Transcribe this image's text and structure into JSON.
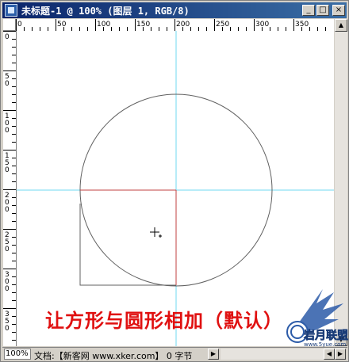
{
  "window": {
    "title": "未标题-1 @ 100% (图层 1, RGB/8)",
    "minimize_glyph": "_",
    "maximize_glyph": "□",
    "close_glyph": "×"
  },
  "ruler": {
    "h_labels": [
      "0",
      "50",
      "100",
      "150",
      "200",
      "250",
      "300",
      "350"
    ],
    "v_labels": [
      "0",
      "50",
      "100",
      "150",
      "200",
      "250",
      "300",
      "350"
    ]
  },
  "status": {
    "zoom": "100%",
    "doc_info": "文档:【新客网 www.xker.com】 0 字节"
  },
  "caption": "让方形与圆形相加（默认）",
  "watermark": {
    "logo_text": "岩月联盟",
    "site": "www.5yue.com"
  },
  "colors": {
    "guide": "#6fd8f0",
    "selection_edge": "#c04040",
    "shape_outline": "#606060",
    "caption": "#e01010"
  },
  "icons": {
    "app": "photoshop-document-icon",
    "cursor": "crosshair-icon"
  }
}
